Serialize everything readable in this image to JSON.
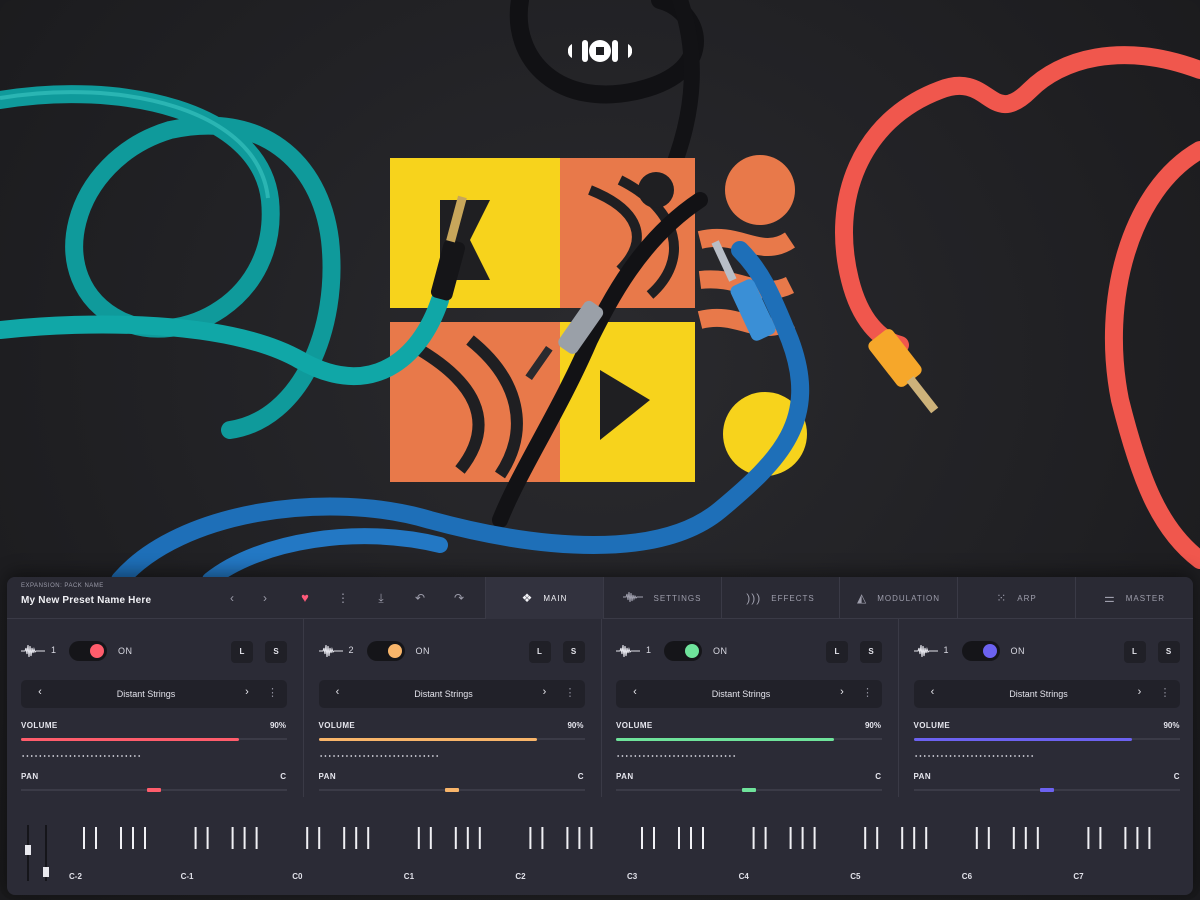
{
  "preset": {
    "pack_label": "EXPANSION: PACK NAME",
    "name": "My New Preset  Name Here"
  },
  "toolbar": {
    "prev_icon": "chevron-left-icon",
    "next_icon": "chevron-right-icon",
    "favorite_icon": "heart-icon",
    "more_icon": "kebab-menu-icon",
    "download_icon": "download-icon",
    "undo_icon": "undo-icon",
    "redo_icon": "redo-icon"
  },
  "tabs": [
    {
      "label": "MAIN",
      "icon": "diamond-grid-icon",
      "active": true
    },
    {
      "label": "SETTINGS",
      "icon": "waveform-icon",
      "active": false
    },
    {
      "label": "EFFECTS",
      "icon": "sound-waves-icon",
      "active": false
    },
    {
      "label": "MODULATION",
      "icon": "modulation-icon",
      "active": false
    },
    {
      "label": "ARP",
      "icon": "arp-dots-icon",
      "active": false
    },
    {
      "label": "MASTER",
      "icon": "sliders-icon",
      "active": false
    }
  ],
  "channels": [
    {
      "num": "1",
      "on_label": "ON",
      "color": "#ff5d6c",
      "l": "L",
      "s": "S",
      "sample": "Distant Strings",
      "volume_label": "VOLUME",
      "volume_value": "90%",
      "volume_fraction": 0.82,
      "pan_label": "PAN",
      "pan_value": "C",
      "pan_position": 0.5
    },
    {
      "num": "2",
      "on_label": "ON",
      "color": "#f8b56a",
      "l": "L",
      "s": "S",
      "sample": "Distant Strings",
      "volume_label": "VOLUME",
      "volume_value": "90%",
      "volume_fraction": 0.82,
      "pan_label": "PAN",
      "pan_value": "C",
      "pan_position": 0.5
    },
    {
      "num": "1",
      "on_label": "ON",
      "color": "#6fe39b",
      "l": "L",
      "s": "S",
      "sample": "Distant Strings",
      "volume_label": "VOLUME",
      "volume_value": "90%",
      "volume_fraction": 0.82,
      "pan_label": "PAN",
      "pan_value": "C",
      "pan_position": 0.5
    },
    {
      "num": "1",
      "on_label": "ON",
      "color": "#6c62f0",
      "l": "L",
      "s": "S",
      "sample": "Distant Strings",
      "volume_label": "VOLUME",
      "volume_value": "90%",
      "volume_fraction": 0.82,
      "pan_label": "PAN",
      "pan_value": "C",
      "pan_position": 0.5
    }
  ],
  "keyboard": {
    "octave_labels": [
      "C-2",
      "C-1",
      "C0",
      "C1",
      "C2",
      "C3",
      "C4",
      "C5",
      "C6",
      "C7"
    ]
  },
  "artwork": {
    "logo_icon": "brand-logo-icon",
    "cover_art": "mixed-cover-art"
  }
}
